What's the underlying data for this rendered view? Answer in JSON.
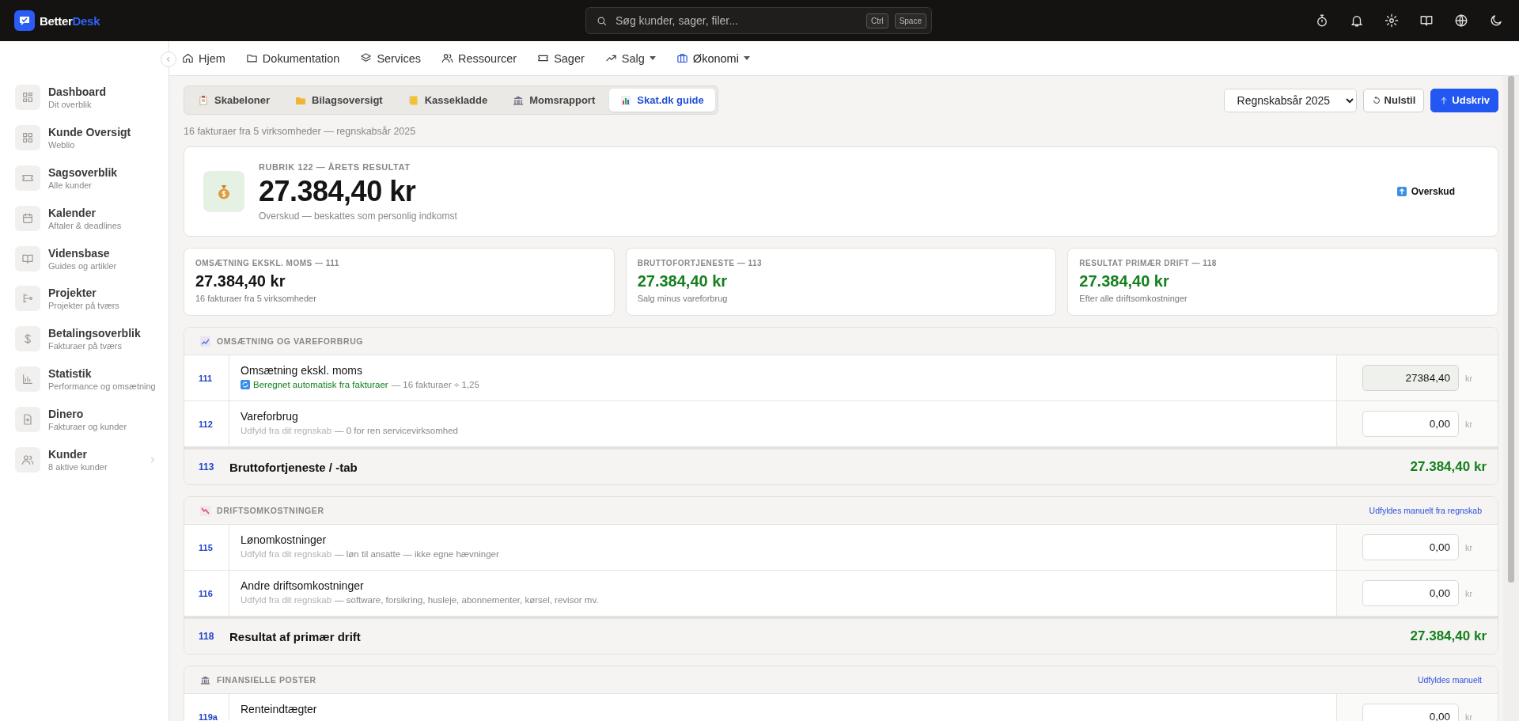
{
  "topbar": {
    "brand_first": "Better",
    "brand_second": "Desk",
    "search": {
      "placeholder": "Søg kunder, sager, filer...",
      "keys": [
        "Ctrl",
        "Space"
      ]
    }
  },
  "nav": [
    {
      "label": "Hjem",
      "dropdown": false,
      "selected": false
    },
    {
      "label": "Dokumentation",
      "dropdown": false,
      "selected": false
    },
    {
      "label": "Services",
      "dropdown": false,
      "selected": false
    },
    {
      "label": "Ressourcer",
      "dropdown": false,
      "selected": false
    },
    {
      "label": "Sager",
      "dropdown": false,
      "selected": false
    },
    {
      "label": "Salg",
      "dropdown": true,
      "selected": false
    },
    {
      "label": "Økonomi",
      "dropdown": true,
      "selected": true
    }
  ],
  "sidebar": {
    "items": [
      {
        "title": "Dashboard",
        "subtitle": "Dit overblik",
        "expandable": false
      },
      {
        "title": "Kunde Oversigt",
        "subtitle": "Weblio",
        "expandable": false
      },
      {
        "title": "Sagsoverblik",
        "subtitle": "Alle kunder",
        "expandable": false
      },
      {
        "title": "Kalender",
        "subtitle": "Aftaler & deadlines",
        "expandable": false
      },
      {
        "title": "Vidensbase",
        "subtitle": "Guides og artikler",
        "expandable": false
      },
      {
        "title": "Projekter",
        "subtitle": "Projekter på tværs",
        "expandable": false
      },
      {
        "title": "Betalingsoverblik",
        "subtitle": "Fakturaer på tværs",
        "expandable": false
      },
      {
        "title": "Statistik",
        "subtitle": "Performance og omsætning",
        "expandable": false
      },
      {
        "title": "Dinero",
        "subtitle": "Fakturaer og kunder",
        "expandable": false
      },
      {
        "title": "Kunder",
        "subtitle": "8 aktive kunder",
        "expandable": true
      }
    ]
  },
  "tabs": [
    {
      "label": "Skabeloner",
      "selected": false
    },
    {
      "label": "Bilagsoversigt",
      "selected": false
    },
    {
      "label": "Kassekladde",
      "selected": false
    },
    {
      "label": "Momsrapport",
      "selected": false
    },
    {
      "label": "Skat.dk guide",
      "selected": true
    }
  ],
  "toolbar": {
    "year_select": "Regnskabsår 2025",
    "reset_button": "Nulstil",
    "print_button": "Udskriv"
  },
  "subtitle": "16 fakturaer fra 5 virksomheder — regnskabsår 2025",
  "hero": {
    "label": "RUBRIK 122 — ÅRETS RESULTAT",
    "amount": "27.384,40 kr",
    "note": "Overskud — beskattes som personlig indkomst",
    "badge": "Overskud"
  },
  "metrics": [
    {
      "label": "OMSÆTNING EKSKL. MOMS — 111",
      "amount": "27.384,40 kr",
      "note": "16 fakturaer fra 5 virksomheder",
      "positive": false
    },
    {
      "label": "BRUTTOFORTJENESTE — 113",
      "amount": "27.384,40 kr",
      "note": "Salg minus vareforbrug",
      "positive": true
    },
    {
      "label": "RESULTAT PRIMÆR DRIFT — 118",
      "amount": "27.384,40 kr",
      "note": "Efter alle driftsomkostninger",
      "positive": true
    }
  ],
  "sections": [
    {
      "kind": "revenue",
      "title": "OMSÆTNING OG VAREFORBRUG",
      "rows": [
        {
          "code": "111",
          "label": "Omsætning ekskl. moms",
          "hint_source": "Beregnet automatisk fra fakturaer",
          "hint_detail": "— 16 fakturaer ÷ 1,25",
          "auto": true,
          "value": "27384,40",
          "unit": "kr"
        },
        {
          "code": "112",
          "label": "Vareforbrug",
          "hint_source": "Udfyld fra dit regnskab",
          "hint_detail": "— 0 for ren servicevirksomhed",
          "auto": false,
          "value": "0,00",
          "unit": "kr"
        }
      ],
      "total": {
        "code": "113",
        "label": "Bruttofortjeneste / -tab",
        "amount": "27.384,40 kr"
      }
    },
    {
      "kind": "costs",
      "title": "DRIFTSOMKOSTNINGER",
      "note": "Udfyldes manuelt fra regnskab",
      "rows": [
        {
          "code": "115",
          "label": "Lønomkostninger",
          "hint_source": "Udfyld fra dit regnskab",
          "hint_detail": "— løn til ansatte — ikke egne hævninger",
          "auto": false,
          "value": "0,00",
          "unit": "kr"
        },
        {
          "code": "116",
          "label": "Andre driftsomkostninger",
          "hint_source": "Udfyld fra dit regnskab",
          "hint_detail": "— software, forsikring, husleje, abonnementer, kørsel, revisor mv.",
          "auto": false,
          "value": "0,00",
          "unit": "kr"
        }
      ],
      "total": {
        "code": "118",
        "label": "Resultat af primær drift",
        "amount": "27.384,40 kr"
      }
    },
    {
      "kind": "finance",
      "title": "FINANSIELLE POSTER",
      "note": "Udfyldes manuelt",
      "rows": [
        {
          "code": "119a",
          "label": "Renteindtægter",
          "auto": false,
          "value": "0,00",
          "unit": "kr"
        }
      ]
    }
  ]
}
